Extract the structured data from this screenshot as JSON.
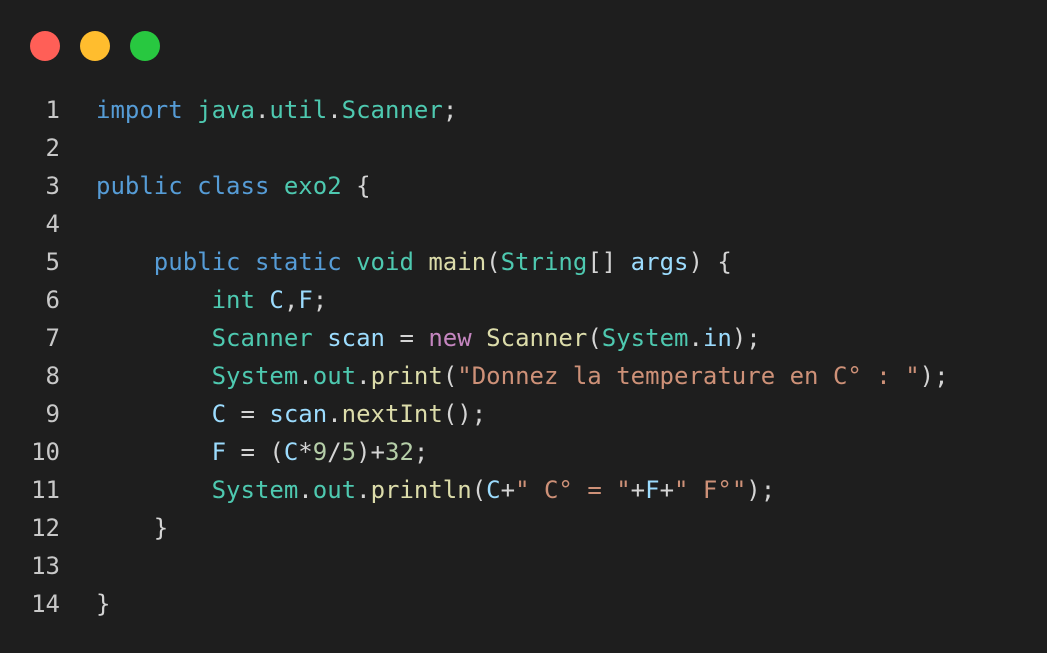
{
  "window": {
    "controls": [
      {
        "name": "close",
        "color": "#ff5f57"
      },
      {
        "name": "minimize",
        "color": "#ffbd2e"
      },
      {
        "name": "maximize",
        "color": "#28c840"
      }
    ]
  },
  "editor": {
    "language": "java",
    "colors": {
      "keyword": "#569cd6",
      "type": "#4ec9b0",
      "function": "#dcdcaa",
      "variable": "#9cdcfe",
      "string": "#ce9178",
      "number": "#b5cea8",
      "control": "#c586c0",
      "plain": "#d4d4d4",
      "line_number": "#c8c8c8",
      "background": "#1e1e1e"
    },
    "lines": [
      {
        "n": "1",
        "tokens": [
          [
            "kw",
            "import"
          ],
          [
            "pl",
            " "
          ],
          [
            "ty",
            "java"
          ],
          [
            "pl",
            "."
          ],
          [
            "ty",
            "util"
          ],
          [
            "pl",
            "."
          ],
          [
            "ty",
            "Scanner"
          ],
          [
            "pl",
            ";"
          ]
        ]
      },
      {
        "n": "2",
        "tokens": []
      },
      {
        "n": "3",
        "tokens": [
          [
            "kw",
            "public"
          ],
          [
            "pl",
            " "
          ],
          [
            "kw",
            "class"
          ],
          [
            "pl",
            " "
          ],
          [
            "ty",
            "exo2"
          ],
          [
            "pl",
            " {"
          ]
        ]
      },
      {
        "n": "4",
        "tokens": []
      },
      {
        "n": "5",
        "tokens": [
          [
            "pl",
            "    "
          ],
          [
            "kw",
            "public"
          ],
          [
            "pl",
            " "
          ],
          [
            "kw",
            "static"
          ],
          [
            "pl",
            " "
          ],
          [
            "ty",
            "void"
          ],
          [
            "pl",
            " "
          ],
          [
            "fn",
            "main"
          ],
          [
            "pl",
            "("
          ],
          [
            "ty",
            "String"
          ],
          [
            "pl",
            "[] "
          ],
          [
            "var",
            "args"
          ],
          [
            "pl",
            ") {"
          ]
        ]
      },
      {
        "n": "6",
        "tokens": [
          [
            "pl",
            "        "
          ],
          [
            "ty",
            "int"
          ],
          [
            "pl",
            " "
          ],
          [
            "var",
            "C"
          ],
          [
            "pl",
            ","
          ],
          [
            "var",
            "F"
          ],
          [
            "pl",
            ";"
          ]
        ]
      },
      {
        "n": "7",
        "tokens": [
          [
            "pl",
            "        "
          ],
          [
            "ty",
            "Scanner"
          ],
          [
            "pl",
            " "
          ],
          [
            "var",
            "scan"
          ],
          [
            "pl",
            " = "
          ],
          [
            "ctl",
            "new"
          ],
          [
            "pl",
            " "
          ],
          [
            "fn",
            "Scanner"
          ],
          [
            "pl",
            "("
          ],
          [
            "ty",
            "System"
          ],
          [
            "pl",
            "."
          ],
          [
            "var",
            "in"
          ],
          [
            "pl",
            ");"
          ]
        ]
      },
      {
        "n": "8",
        "tokens": [
          [
            "pl",
            "        "
          ],
          [
            "ty",
            "System"
          ],
          [
            "pl",
            "."
          ],
          [
            "ty",
            "out"
          ],
          [
            "pl",
            "."
          ],
          [
            "fn",
            "print"
          ],
          [
            "pl",
            "("
          ],
          [
            "str",
            "\"Donnez la temperature en C° : \""
          ],
          [
            "pl",
            ");"
          ]
        ]
      },
      {
        "n": "9",
        "tokens": [
          [
            "pl",
            "        "
          ],
          [
            "var",
            "C"
          ],
          [
            "pl",
            " = "
          ],
          [
            "var",
            "scan"
          ],
          [
            "pl",
            "."
          ],
          [
            "fn",
            "nextInt"
          ],
          [
            "pl",
            "();"
          ]
        ]
      },
      {
        "n": "10",
        "tokens": [
          [
            "pl",
            "        "
          ],
          [
            "var",
            "F"
          ],
          [
            "pl",
            " = ("
          ],
          [
            "var",
            "C"
          ],
          [
            "pl",
            "*"
          ],
          [
            "num",
            "9"
          ],
          [
            "pl",
            "/"
          ],
          [
            "num",
            "5"
          ],
          [
            "pl",
            ")+"
          ],
          [
            "num",
            "32"
          ],
          [
            "pl",
            ";"
          ]
        ]
      },
      {
        "n": "11",
        "tokens": [
          [
            "pl",
            "        "
          ],
          [
            "ty",
            "System"
          ],
          [
            "pl",
            "."
          ],
          [
            "ty",
            "out"
          ],
          [
            "pl",
            "."
          ],
          [
            "fn",
            "println"
          ],
          [
            "pl",
            "("
          ],
          [
            "var",
            "C"
          ],
          [
            "pl",
            "+"
          ],
          [
            "str",
            "\" C° = \""
          ],
          [
            "pl",
            "+"
          ],
          [
            "var",
            "F"
          ],
          [
            "pl",
            "+"
          ],
          [
            "str",
            "\" F°\""
          ],
          [
            "pl",
            ");"
          ]
        ]
      },
      {
        "n": "12",
        "tokens": [
          [
            "pl",
            "    }"
          ]
        ]
      },
      {
        "n": "13",
        "tokens": []
      },
      {
        "n": "14",
        "tokens": [
          [
            "pl",
            "}"
          ]
        ]
      }
    ]
  }
}
